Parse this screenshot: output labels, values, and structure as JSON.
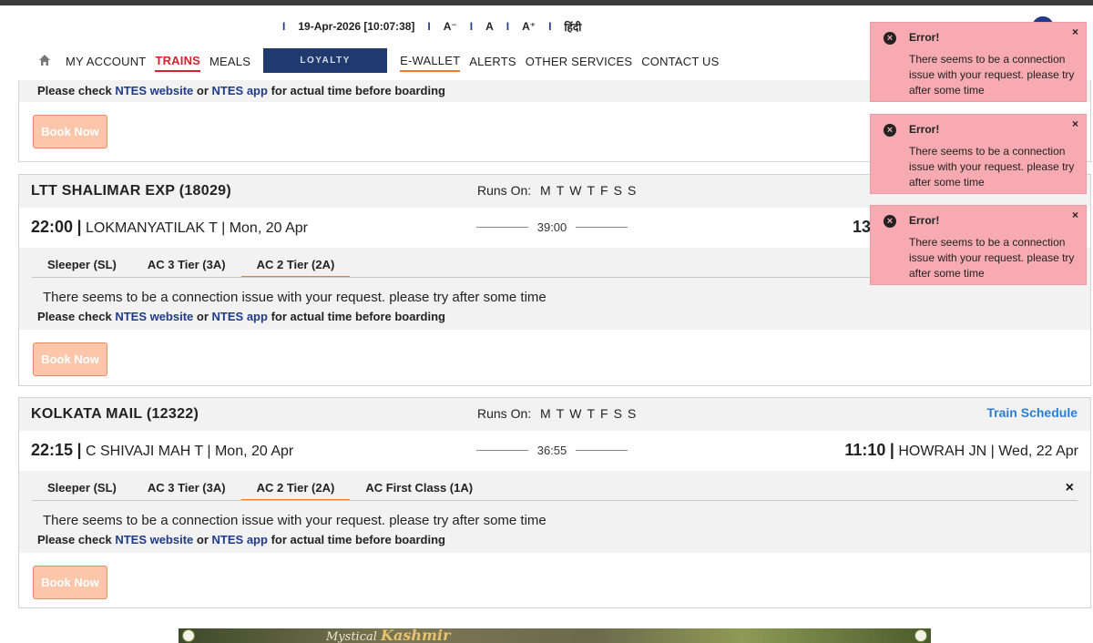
{
  "header": {
    "separator": "I",
    "datetime": "19-Apr-2026 [10:07:38]",
    "font_decrease": "A⁻",
    "font_normal": "A",
    "font_increase": "A⁺",
    "language": "हिंदी"
  },
  "nav": {
    "my_account": "MY ACCOUNT",
    "trains": "TRAINS",
    "meals": "MEALS",
    "loyalty": "LOYALTY",
    "ewallet": "E-WALLET",
    "alerts": "ALERTS",
    "other_services": "OTHER SERVICES",
    "contact_us": "CONTACT US"
  },
  "common": {
    "runs_on_label": "Runs On:",
    "days": [
      "M",
      "T",
      "W",
      "T",
      "F",
      "S",
      "S"
    ],
    "connection_error": "There seems to be a connection issue with your request. please try after some time",
    "ntes_prefix": "Please check",
    "ntes_website": "NTES website",
    "ntes_or": "or",
    "ntes_app": "NTES app",
    "ntes_suffix": "for actual time before boarding",
    "book_now": "Book Now",
    "train_schedule": "Train Schedule",
    "close": "×"
  },
  "trains": [
    {
      "name": "LTT SHALIMAR EXP (18029)",
      "dep_time": "22:00",
      "dep_station": "LOKMANYATILAK T | Mon, 20 Apr",
      "duration": "39:00",
      "arr_time": "13",
      "classes": [
        "Sleeper (SL)",
        "AC 3 Tier (3A)",
        "AC 2 Tier (2A)"
      ],
      "active_class": 2
    },
    {
      "name": "KOLKATA MAIL (12322)",
      "dep_time": "22:15",
      "dep_station": "C SHIVAJI MAH T | Mon, 20 Apr",
      "duration": "36:55",
      "arr_time": "11:10",
      "arr_station": "HOWRAH JN | Wed, 22 Apr",
      "classes": [
        "Sleeper (SL)",
        "AC 3 Tier (3A)",
        "AC 2 Tier (2A)",
        "AC First Class (1A)"
      ],
      "active_class": 2
    }
  ],
  "toasts": [
    {
      "title": "Error!",
      "message": "There seems to be a connection issue with your request. please try after some time",
      "close": "×"
    },
    {
      "title": "Error!",
      "message": "There seems to be a connection issue with your request. please try after some time",
      "close": "×"
    },
    {
      "title": "Error!",
      "message": "There seems to be a connection issue with your request. please try after some time",
      "close": "×"
    }
  ],
  "banner": {
    "text_prefix": "Mystical",
    "text_main": "Kashmir"
  },
  "colors": {
    "accent_red": "#d7212b",
    "accent_orange": "#f07b2c",
    "link_blue": "#1f3a8a",
    "schedule_blue": "#2a7fd4",
    "toast_bg": "#f7aab1",
    "book_bg": "#fcc6ab",
    "loyalty_bg": "#1f3a6e"
  },
  "icons": {
    "home": "home-icon",
    "error": "error-circle-icon",
    "close": "close-icon"
  }
}
